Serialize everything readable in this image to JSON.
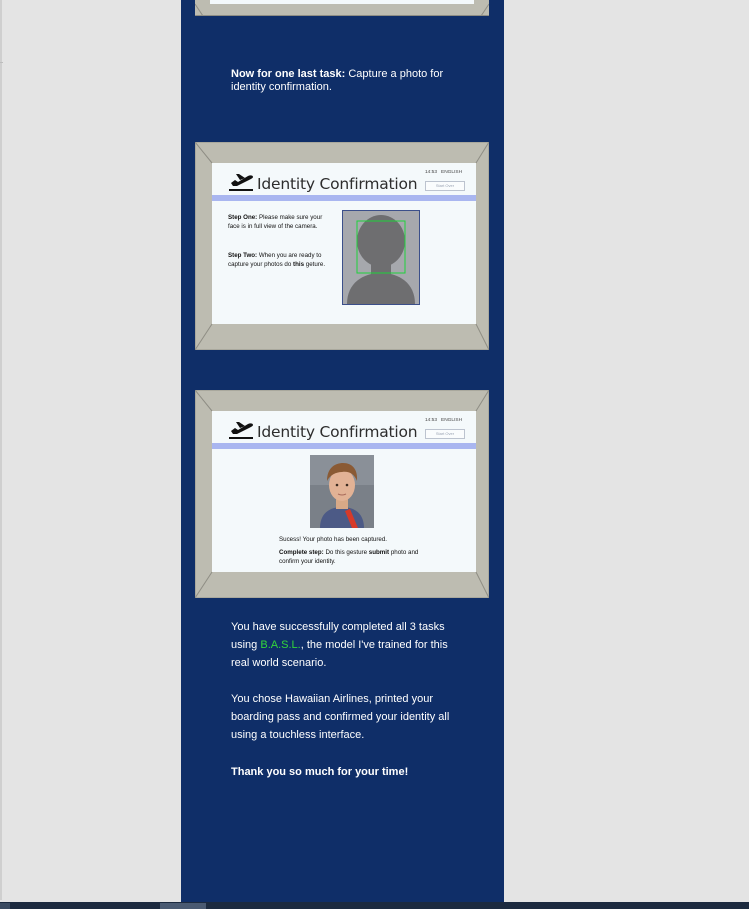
{
  "mockup1": {
    "title": "Identity Confirmation",
    "time": "14:53",
    "language": "ENGLISH",
    "start_label": "Start Over",
    "step1_bold": "Step One:",
    "step1_text": "Please make sure your face is in full view of the camera.",
    "step2_bold": "Step Two:",
    "step2_text_a": "When you are ready to capture your photos do",
    "step2_bold_word": "this",
    "step2_text_b": "geture."
  },
  "mockup2": {
    "title": "Identity Confirmation",
    "time": "14:53",
    "language": "ENGLISH",
    "start_label": "Start Over",
    "success": "Sucess! Your photo has been captured.",
    "complete_bold": "Complete step:",
    "complete_text_a": "Do this gesture",
    "complete_bold_word": "submit",
    "complete_text_b": "photo and confirm your identity."
  },
  "intro": {
    "bold": "Now for one last task:",
    "text": "Capture a photo for identity confirmation."
  },
  "summary": {
    "line1_a": "You have successfully completed all 3 tasks using",
    "highlight": "B.A.S.L.",
    "line1_b": ", the model I've trained for this real world scenario.",
    "para2": "You chose Hawaiian Airlines, printed your boarding pass and confirmed your identity all using a touchless interface.",
    "thanks": "Thank you so much for your time!"
  },
  "colors": {
    "panel": "#0f2e68",
    "accent_green": "#33d63a",
    "stripe": "#a9b6f0",
    "page_bg": "#e4e4e4"
  }
}
